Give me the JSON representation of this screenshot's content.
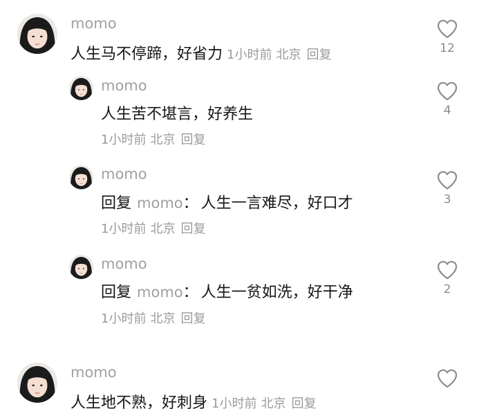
{
  "comments": [
    {
      "username": "momo",
      "text": "人生马不停蹄，好省力",
      "time": "1小时前",
      "location": "北京",
      "reply_label": "回复",
      "likes": "12"
    },
    {
      "username": "momo",
      "text": "人生苦不堪言，好养生",
      "time": "1小时前",
      "location": "北京",
      "reply_label": "回复",
      "likes": "4"
    },
    {
      "username": "momo",
      "reply_prefix": "回复",
      "reply_target": "momo",
      "reply_colon": "：",
      "text": "人生一言难尽，好口才",
      "time": "1小时前",
      "location": "北京",
      "reply_label": "回复",
      "likes": "3"
    },
    {
      "username": "momo",
      "reply_prefix": "回复",
      "reply_target": "momo",
      "reply_colon": "：",
      "text": "人生一贫如洗，好干净",
      "time": "1小时前",
      "location": "北京",
      "reply_label": "回复",
      "likes": "2"
    },
    {
      "username": "momo",
      "text": "人生地不熟，好刺身",
      "time": "1小时前",
      "location": "北京",
      "reply_label": "回复",
      "likes": ""
    }
  ],
  "icons": {
    "like": "heart-outline-icon",
    "avatar": "avatar-portrait"
  },
  "colors": {
    "text": "#161616",
    "muted": "#9a9a9a",
    "icon": "#8c8c8c"
  }
}
